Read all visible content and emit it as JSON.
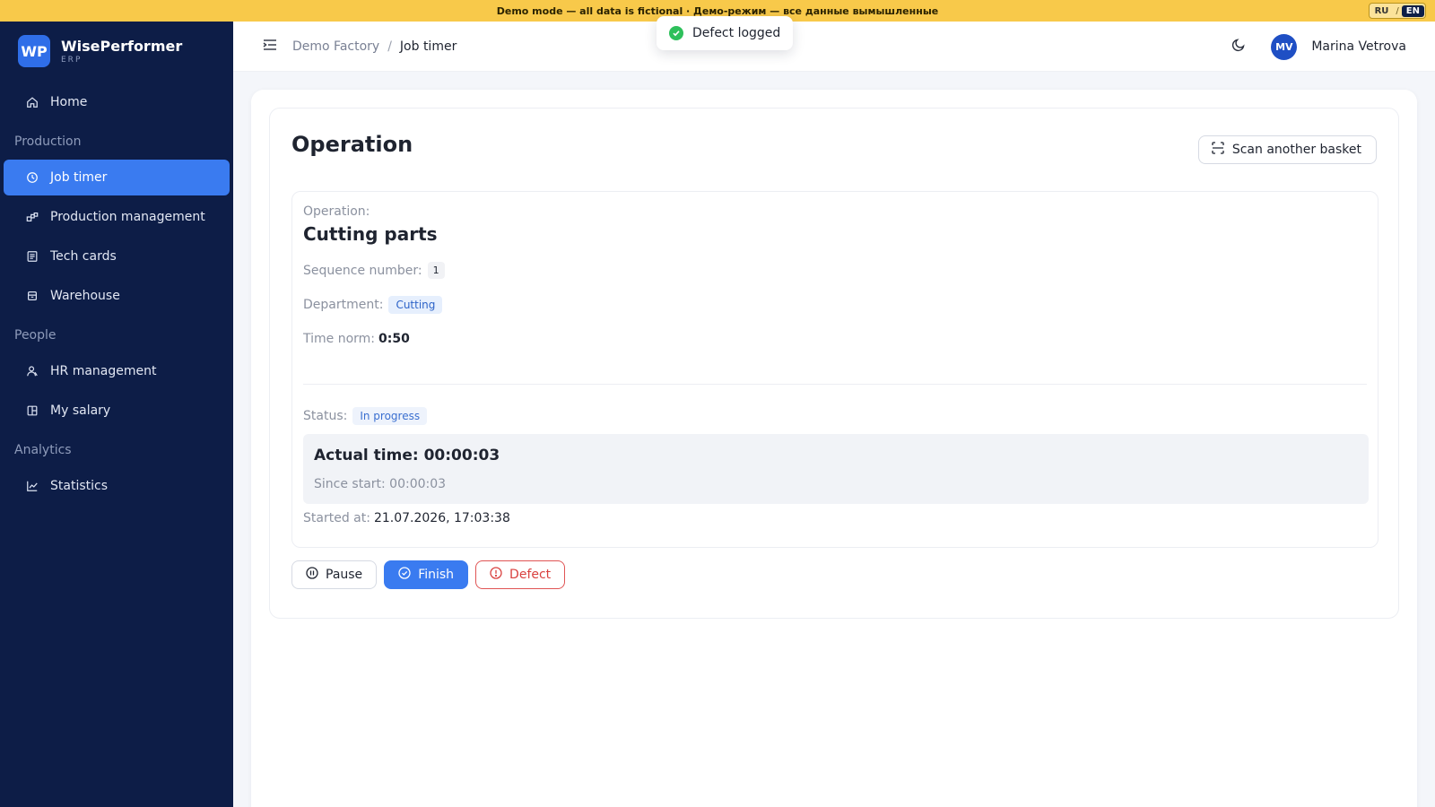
{
  "banner": {
    "text": "Demo mode — all data is fictional · Демо-режим — все данные вымышленные",
    "lang_ru": "RU",
    "lang_sep": "/",
    "lang_en": "EN",
    "active_lang": "EN"
  },
  "brand": {
    "logo": "WP",
    "name": "WisePerformer",
    "sub": "ERP"
  },
  "sidebar": {
    "home": "Home",
    "section_production": "Production",
    "job_timer": "Job timer",
    "production_management": "Production management",
    "tech_cards": "Tech cards",
    "warehouse": "Warehouse",
    "section_people": "People",
    "hr_management": "HR management",
    "my_salary": "My salary",
    "section_analytics": "Analytics",
    "statistics": "Statistics",
    "active_item": "Job timer"
  },
  "topbar": {
    "breadcrumb_parent": "Demo Factory",
    "breadcrumb_sep": "/",
    "breadcrumb_current": "Job timer",
    "avatar_initials": "MV",
    "user_name": "Marina Vetrova"
  },
  "toast": {
    "message": "Defect logged"
  },
  "main": {
    "title": "Operation",
    "scan_button": "Scan another basket",
    "operation_label": "Operation:",
    "operation_name": "Cutting parts",
    "sequence_label": "Sequence number:",
    "sequence_value": "1",
    "department_label": "Department:",
    "department_value": "Cutting",
    "time_norm_label": "Time norm:",
    "time_norm_value": "0:50",
    "status_label": "Status:",
    "status_value": "In progress",
    "actual_time": "Actual time: 00:00:03",
    "since_start": "Since start: 00:00:03",
    "started_at_label": "Started at:",
    "started_at_value": "21.07.2026, 17:03:38",
    "pause_button": "Pause",
    "finish_button": "Finish",
    "defect_button": "Defect"
  },
  "colors": {
    "banner": "#f8c94a",
    "sidebar": "#0d1d47",
    "accent": "#3a7bf0",
    "danger": "#d9413f",
    "success": "#2ec05b"
  },
  "icons": {
    "home": "home-icon",
    "job_timer": "clock-icon",
    "production_management": "blocks-icon",
    "tech_cards": "document-icon",
    "warehouse": "box-icon",
    "hr_management": "users-icon",
    "my_salary": "wallet-icon",
    "statistics": "line-chart-icon",
    "scan": "scan-icon",
    "pause": "pause-icon",
    "finish": "check-circle-icon",
    "defect": "alert-circle-icon",
    "toast": "check-icon",
    "theme": "moon-icon",
    "menu": "menu-icon"
  }
}
